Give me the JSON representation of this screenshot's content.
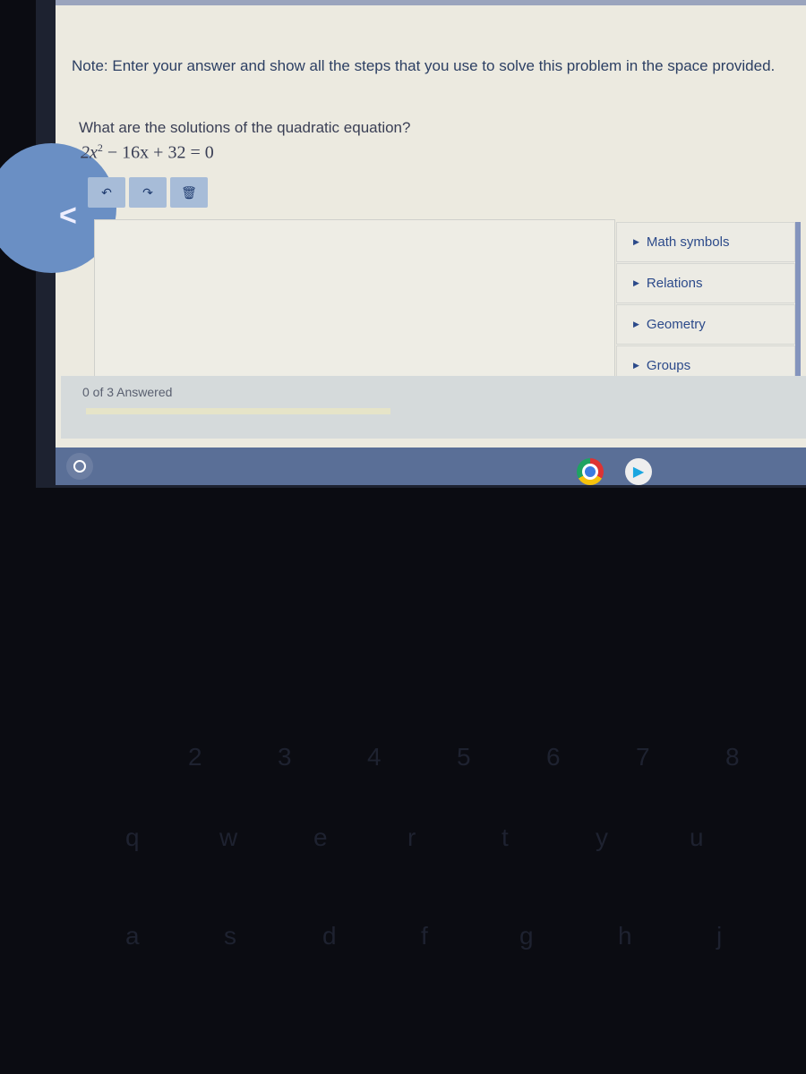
{
  "note": "Note: Enter your answer and show all the steps that you use to solve this problem in the space provided.",
  "question": "What are the solutions of the quadratic equation?",
  "equation": {
    "a": "2x",
    "exp": "2",
    "rest": " − 16x + 32 = 0"
  },
  "toolbar": {
    "undo_icon": "undo-icon",
    "redo_icon": "redo-icon",
    "trash_icon": "trash-icon"
  },
  "panel": {
    "items": [
      {
        "label": "Math symbols"
      },
      {
        "label": "Relations"
      },
      {
        "label": "Geometry"
      },
      {
        "label": "Groups"
      }
    ]
  },
  "status": {
    "text": "0 of 3 Answered",
    "progress_fraction": 0
  },
  "shelf": {
    "apps": [
      "launcher-icon",
      "chrome-icon",
      "play-store-icon"
    ]
  },
  "colors": {
    "accent": "#6a8fc4",
    "link": "#2c4a8a",
    "shelf": "#5a6f97"
  },
  "keyboard": {
    "keys": [
      "2",
      "3",
      "4",
      "5",
      "6",
      "7",
      "8",
      "q",
      "w",
      "e",
      "r",
      "t",
      "y",
      "u",
      "a",
      "s",
      "d",
      "f",
      "g",
      "h",
      "j"
    ]
  }
}
